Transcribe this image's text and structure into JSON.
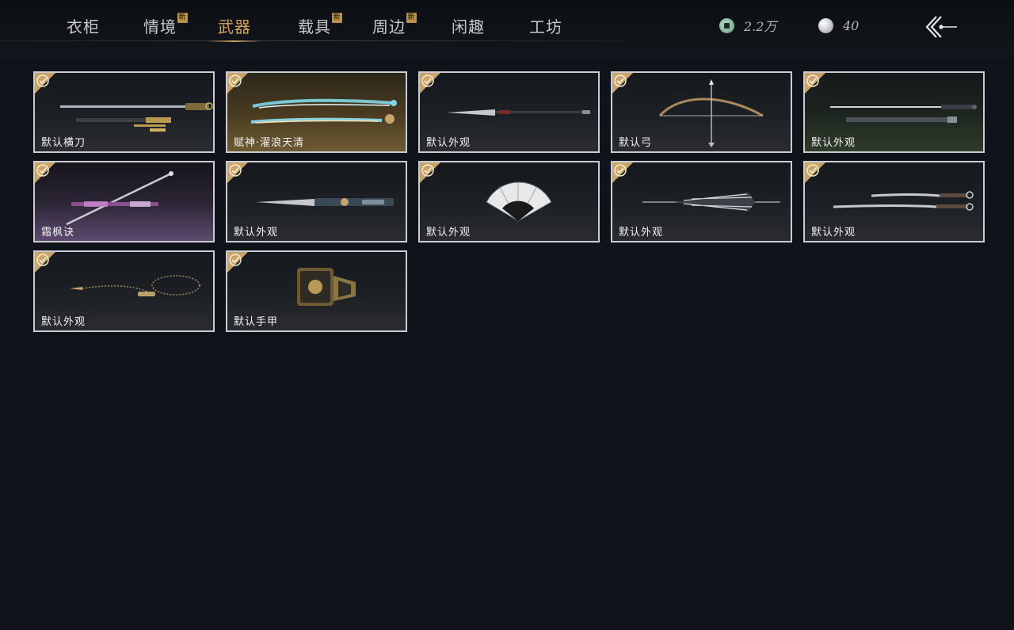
{
  "nav": {
    "tabs": [
      {
        "label": "衣柜",
        "new": false,
        "badge": ""
      },
      {
        "label": "情境",
        "new": true,
        "badge": "新"
      },
      {
        "label": "武器",
        "new": false,
        "badge": "",
        "active": true
      },
      {
        "label": "载具",
        "new": true,
        "badge": "新"
      },
      {
        "label": "周边",
        "new": true,
        "badge": "新"
      },
      {
        "label": "闲趣",
        "new": false,
        "badge": ""
      },
      {
        "label": "工坊",
        "new": false,
        "badge": ""
      }
    ]
  },
  "currency": {
    "coins": {
      "icon": "jade-coin-icon",
      "value": "2.2万"
    },
    "pearls": {
      "icon": "pearl-icon",
      "value": "40"
    }
  },
  "back_button": {
    "icon": "back-arrow-icon"
  },
  "items": [
    {
      "label": "默认横刀",
      "owned": true,
      "art": "sword-icon"
    },
    {
      "label": "赋神·濯浪天清",
      "owned": true,
      "art": "glowing-blade-icon"
    },
    {
      "label": "默认外观",
      "owned": true,
      "art": "spear-icon"
    },
    {
      "label": "默认弓",
      "owned": true,
      "art": "bow-icon"
    },
    {
      "label": "默认外观",
      "owned": true,
      "art": "twin-swords-icon"
    },
    {
      "label": "霜枫诀",
      "owned": true,
      "art": "dual-blade-icon"
    },
    {
      "label": "默认外观",
      "owned": true,
      "art": "long-blade-icon"
    },
    {
      "label": "默认外观",
      "owned": true,
      "art": "fan-icon"
    },
    {
      "label": "默认外观",
      "owned": true,
      "art": "umbrella-icon"
    },
    {
      "label": "默认外观",
      "owned": true,
      "art": "katana-pair-icon"
    },
    {
      "label": "默认外观",
      "owned": true,
      "art": "rope-dart-icon"
    },
    {
      "label": "默认手甲",
      "owned": true,
      "art": "gauntlet-icon"
    }
  ],
  "colors": {
    "accent": "#d4a35a",
    "background": "#10141a",
    "card_border": "#c9cdd2",
    "owned_badge": "#c9a46a"
  }
}
